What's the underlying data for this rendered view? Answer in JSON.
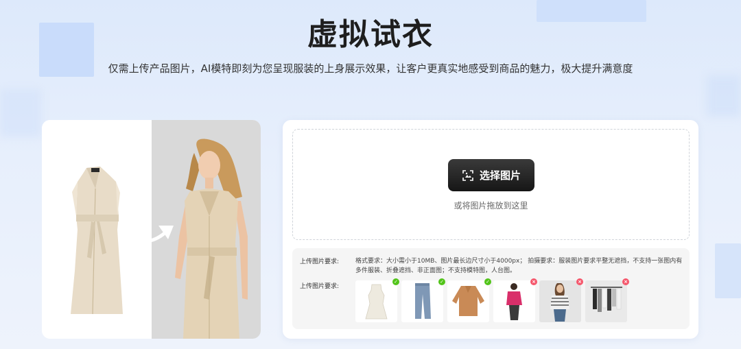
{
  "header": {
    "title": "虚拟试衣",
    "subtitle": "仅需上传产品图片，AI模特即刻为您呈现服装的上身展示效果，让客户更真实地感受到商品的魅力，极大提升满意度"
  },
  "upload": {
    "button_label": "选择图片",
    "button_icon": "scan-image-icon",
    "drop_hint": "或将图片拖放到这里"
  },
  "requirements": {
    "label_1": "上传图片要求:",
    "text": "格式要求：大小需小于10MB、图片最长边尺寸小于4000px； 拍摄要求：服装图片要求平整无遮挡，不支持一张图内有多件服装、折叠遮挡、非正面图；不支持模特图，人台图。",
    "label_2": "上传图片要求:",
    "examples": [
      {
        "name": "white-dress",
        "status": "ok"
      },
      {
        "name": "jeans",
        "status": "ok"
      },
      {
        "name": "sweater",
        "status": "ok"
      },
      {
        "name": "model-pink-top",
        "status": "bad"
      },
      {
        "name": "model-striped-top",
        "status": "bad"
      },
      {
        "name": "clothes-rack",
        "status": "bad"
      }
    ]
  },
  "colors": {
    "ok": "#52c41a",
    "bad": "#f5576c",
    "button": "#1f1f1f"
  }
}
